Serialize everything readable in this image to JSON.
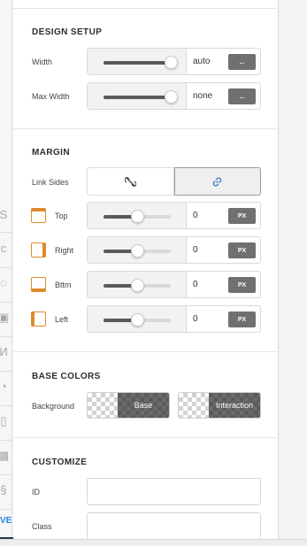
{
  "left_strip": {
    "glyphs": [
      "S",
      "c",
      "◌",
      "▣",
      "И",
      "◔",
      "▯",
      "▩",
      "§"
    ],
    "edge_text": "VE"
  },
  "design_setup": {
    "heading": "DESIGN SETUP",
    "width": {
      "label": "Width",
      "value": "auto",
      "level": 1.0,
      "unit_button": "..."
    },
    "max_width": {
      "label": "Max Width",
      "value": "none",
      "level": 1.0,
      "unit_button": "..."
    }
  },
  "margin": {
    "heading": "MARGIN",
    "link_sides_label": "Link Sides",
    "link_active": "linked",
    "sides": [
      {
        "key": "top",
        "label": "Top",
        "value": "0",
        "unit": "PX",
        "level": 0.5
      },
      {
        "key": "right",
        "label": "Right",
        "value": "0",
        "unit": "PX",
        "level": 0.5
      },
      {
        "key": "bottom",
        "label": "Bttm",
        "value": "0",
        "unit": "PX",
        "level": 0.5
      },
      {
        "key": "left",
        "label": "Left",
        "value": "0",
        "unit": "PX",
        "level": 0.5
      }
    ]
  },
  "base_colors": {
    "heading": "BASE COLORS",
    "background_label": "Background",
    "base_label": "Base",
    "interaction_label": "Interaction"
  },
  "customize": {
    "heading": "CUSTOMIZE",
    "id_label": "ID",
    "id_value": "",
    "class_label": "Class",
    "class_value": ""
  },
  "colors": {
    "accent_orange": "#e08a2a",
    "link_blue": "#3a7ebf",
    "unit_button": "#707070"
  }
}
